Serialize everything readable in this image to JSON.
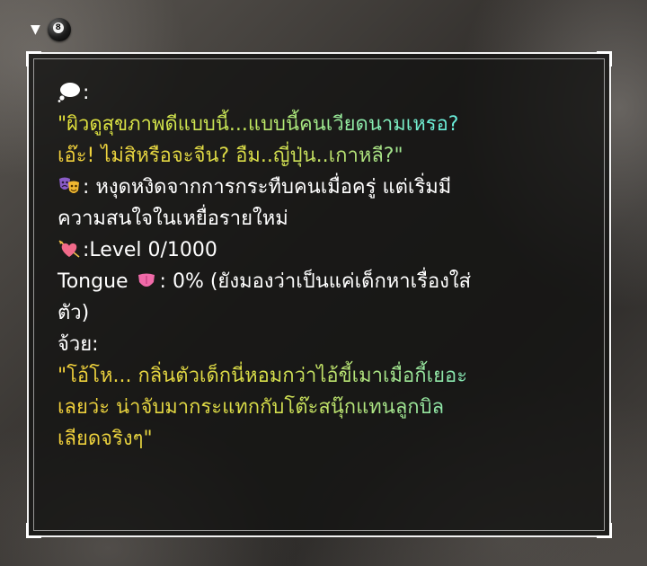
{
  "thought_section": {
    "icon": "thought-bubble-icon",
    "label": ":",
    "quote_lines": [
      "\"ผิวดูสุขภาพดีแบบนี้...แบบนี้คนเวียดนามเหรอ?",
      "เอ๊ะ! ไม่สิหรือจะจีน? อืม..ญี่ปุ่น..เกาหลี?\""
    ]
  },
  "mood_section": {
    "icon": "performing-arts-masks-icon",
    "lines": [
      ": หงุดหงิดจากการกระทืบคนเมื่อครู่ แต่เริ่มมี",
      "ความสนใจในเหยื่อรายใหม่"
    ]
  },
  "level_section": {
    "icon": "heart-arrow-icon",
    "text": ":Level 0/1000"
  },
  "tongue_section": {
    "label": "Tongue",
    "icon": "tongue-icon",
    "lines": [
      ": 0% (ยังมองว่าเป็นแค่เด็กหาเรื่องใส่",
      "ตัว)"
    ]
  },
  "speaker_section": {
    "label": "จ้วย:",
    "quote_lines": [
      "\"โอ้โห... กลิ่นตัวเด็กนี่หอมกว่าไอ้ขี้เมาเมื่อกี้เยอะ",
      "เลยว่ะ น่าจับมากระแทกกับโต๊ะสนุ๊กแทนลูกบิล",
      "เลียดจริงๆ\""
    ]
  },
  "header": {
    "toggle_icon": "caret-down-icon",
    "ball_icon": "eight-ball-icon",
    "caret_glyph": "▼",
    "ball_number": "8"
  },
  "colors": {
    "quote_gradient_start": "#e6e23a",
    "quote_gradient_end": "#54e8f0",
    "text": "#ffffff",
    "frame": "#f2f2f2"
  }
}
